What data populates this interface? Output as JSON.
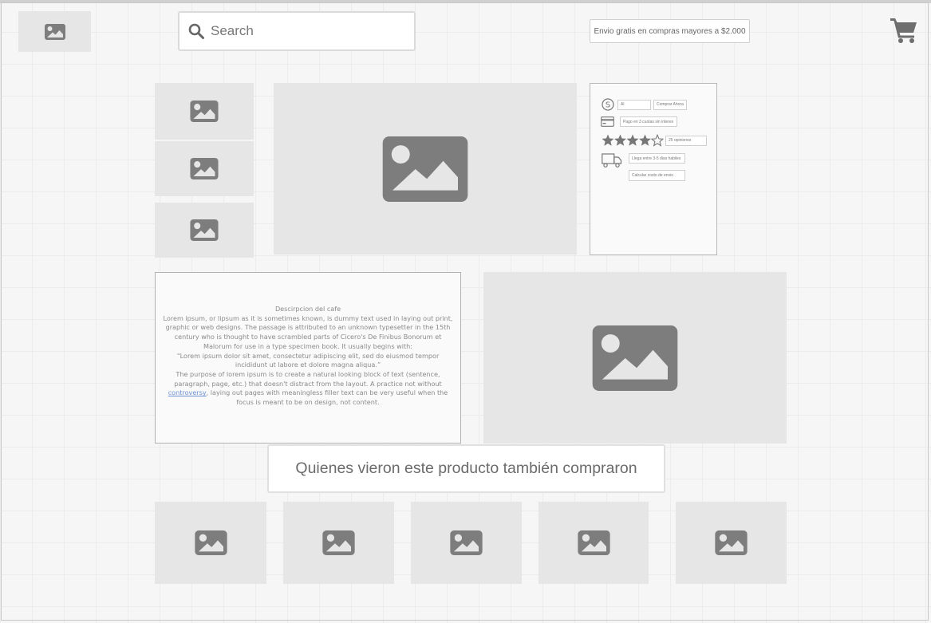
{
  "header": {
    "logo_icon": "image-icon",
    "search": {
      "placeholder": "Search",
      "value": "",
      "icon": "search-icon"
    },
    "shipping_notice": "Envio gratis en compras mayores a $2.000",
    "cart_icon": "cart-icon"
  },
  "gallery": {
    "thumbnails": [
      "image-icon",
      "image-icon",
      "image-icon"
    ],
    "main_image": "image-icon"
  },
  "purchase_panel": {
    "price": "Al",
    "buy_now": "Comprar Ahora",
    "payment": "Pago en 3 cuotas sin interes",
    "rating": {
      "value": 4,
      "max": 5,
      "reviews": "25 opiniones"
    },
    "delivery": "Llega entre 3-5 dias habiles",
    "shipping_cost": "Calcular costo de envio"
  },
  "description": {
    "title": "Descirpcion del cafe",
    "p1": "Lorem ipsum, or lipsum as it is sometimes known, is dummy text used in laying out print, graphic or web designs. The passage is attributed to an unknown typesetter in the 15th century who is thought to have scrambled parts of Cicero's De Finibus Bonorum et Malorum for use in a type specimen book. It usually begins with:",
    "quote": "“Lorem ipsum dolor sit amet, consectetur adipiscing elit, sed do eiusmod tempor incididunt ut labore et dolore magna aliqua.”",
    "p2_before": "The purpose of lorem ipsum is to create a natural looking block of text (sentence, paragraph, page, etc.) that doesn't distract from the layout. A practice not without",
    "p2_link": "controversy",
    "p2_after": ", laying out pages with meaningless filler text can be very useful when the focus is meant to be on design, not content."
  },
  "secondary_image": "image-icon",
  "related": {
    "title": "Quienes vieron este producto también compraron",
    "items": [
      "image-icon",
      "image-icon",
      "image-icon",
      "image-icon",
      "image-icon"
    ]
  },
  "colors": {
    "placeholder_bg": "#e6e6e6",
    "icon": "#7d7d7d",
    "link": "#6a8fd6"
  }
}
